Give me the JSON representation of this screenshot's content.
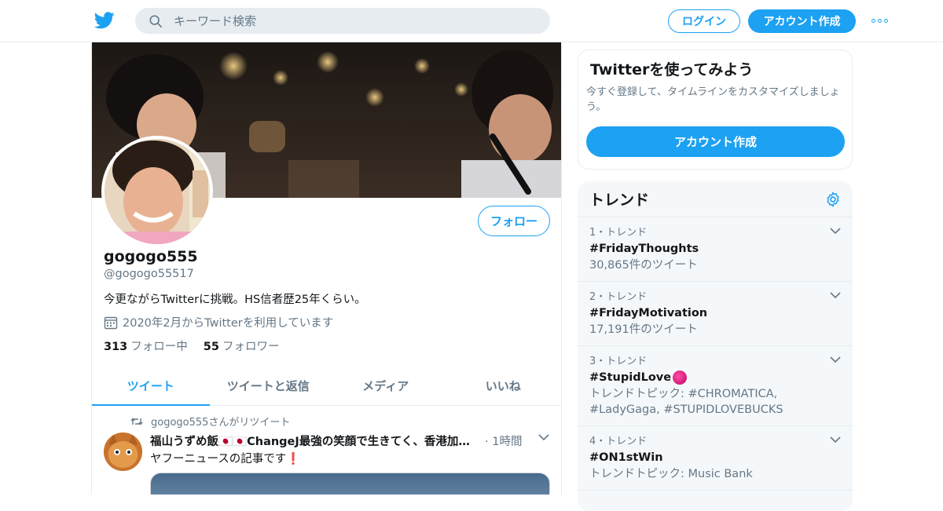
{
  "header": {
    "search_placeholder": "キーワード検索",
    "login_label": "ログイン",
    "signup_label": "アカウント作成"
  },
  "profile": {
    "follow_label": "フォロー",
    "display_name": "gogogo555",
    "handle": "@gogogo55517",
    "bio": "今更ながらTwitterに挑戦。HS信者歴25年くらい。",
    "joined": "2020年2月からTwitterを利用しています",
    "following_count": "313",
    "following_label": "フォロー中",
    "followers_count": "55",
    "followers_label": "フォロワー"
  },
  "tabs": [
    {
      "label": "ツイート",
      "active": true
    },
    {
      "label": "ツイートと返信",
      "active": false
    },
    {
      "label": "メディア",
      "active": false
    },
    {
      "label": "いいね",
      "active": false
    }
  ],
  "tweet": {
    "retweet_by": "gogogo555さんがリツイート",
    "author": "福山うずめ飯🇯🇵🇯🇵ChangeJ最強の笑顔で生きてく、香港加油🇭🇰",
    "time": "· 1時間",
    "text": "ヤフーニュースの記事です❗"
  },
  "sidebar": {
    "try_title": "Twitterを使ってみよう",
    "try_text": "今すぐ登録して、タイムラインをカスタマイズしましょう。",
    "try_button": "アカウント作成",
    "trends_title": "トレンド",
    "trends": [
      {
        "meta": "1・トレンド",
        "tag": "#FridayThoughts",
        "sub": "30,865件のツイート"
      },
      {
        "meta": "2・トレンド",
        "tag": "#FridayMotivation",
        "sub": "17,191件のツイート"
      },
      {
        "meta": "3・トレンド",
        "tag": "#StupidLove",
        "sub": "トレンドトピック: #CHROMATICA, #LadyGaga, #STUPIDLOVEBUCKS"
      },
      {
        "meta": "4・トレンド",
        "tag": "#ON1stWin",
        "sub": "トレンドトピック: Music Bank"
      }
    ]
  },
  "colors": {
    "accent": "#1da1f2",
    "text": "#14171a",
    "muted": "#657786",
    "border": "#e6ecf0"
  }
}
